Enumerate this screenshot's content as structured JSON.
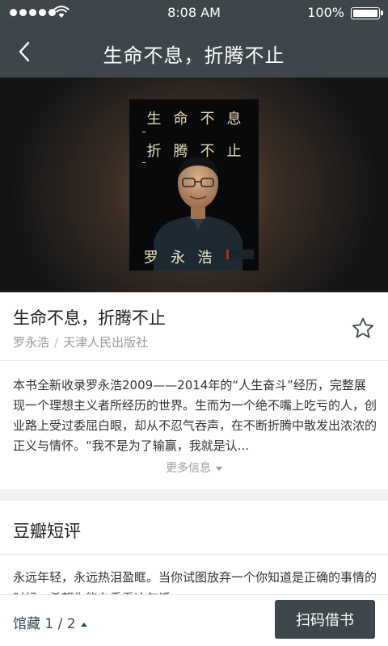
{
  "status_bar": {
    "time": "8:08 AM",
    "battery": "100%",
    "icons": [
      "signal-icon",
      "wifi-icon",
      "battery-icon"
    ]
  },
  "nav": {
    "title": "生命不息，折腾不止",
    "back_icon": "chevron-left-icon"
  },
  "cover": {
    "line1": [
      "生",
      "命",
      "不",
      "息"
    ],
    "line2": [
      "折",
      "腾",
      "不",
      "止"
    ],
    "author": [
      "罗",
      "永",
      "浩"
    ]
  },
  "book": {
    "title": "生命不息，折腾不止",
    "author": "罗永浩",
    "separator": "/",
    "publisher": "天津人民出版社",
    "favorite_icon": "star-outline-icon"
  },
  "description": {
    "text": "本书全新收录罗永浩2009——2014年的“人生奋斗”经历，完整展现一个理想主义者所经历的世界。生而为一个绝不嘴上吃亏的人，创业路上受过委屈白眼，却从不忍气吞声，在不断折腾中散发出浓浓的正义与情怀。“我不是为了输赢，我就是认...",
    "more_label": "更多信息"
  },
  "reviews": {
    "title": "豆瓣短评",
    "first_review": "永远年轻，永远热泪盈眶。当你试图放弃一个你知道是正确的事情的时候，希望你能在重看这句话。"
  },
  "bottom_bar": {
    "holdings_label": "馆藏 1 / 2",
    "scan_button": "扫码借书"
  },
  "colors": {
    "header_bg": "#3d474b",
    "accent_text": "#2f4a55",
    "muted_text": "#999999"
  }
}
